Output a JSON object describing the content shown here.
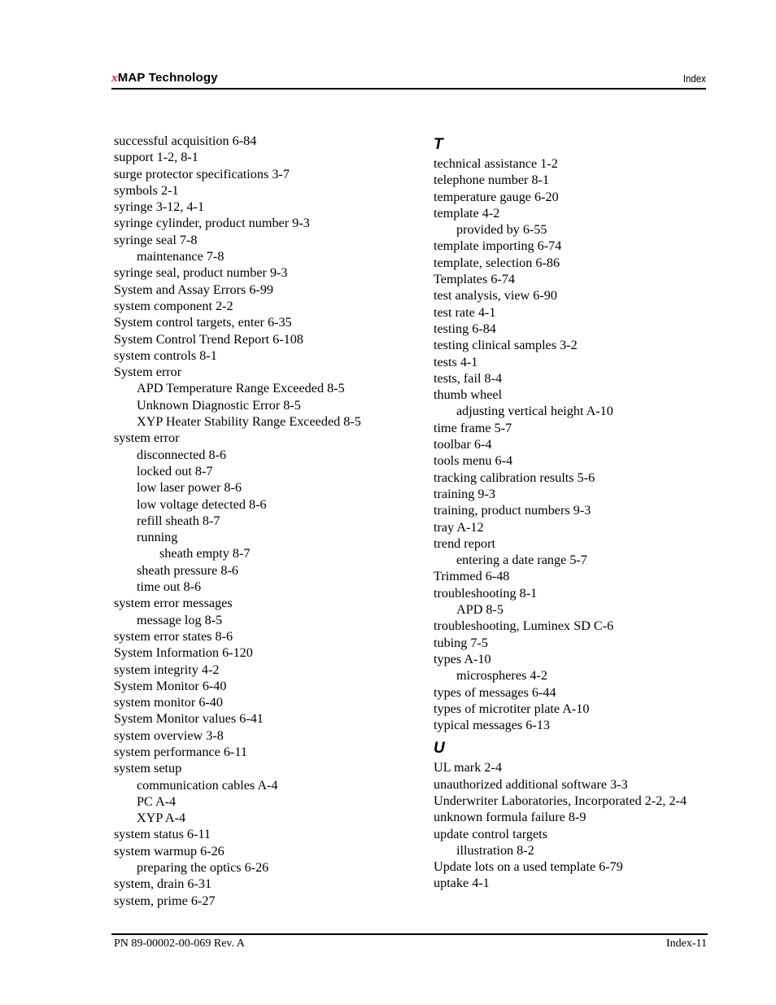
{
  "header": {
    "brand_prefix": "x",
    "brand_name": "MAP Technology",
    "section": "Index",
    "brand_color": "#e0201b"
  },
  "left_column": [
    {
      "text": "successful acquisition 6-84",
      "level": 0
    },
    {
      "text": "support 1-2, 8-1",
      "level": 0
    },
    {
      "text": "surge protector specifications 3-7",
      "level": 0
    },
    {
      "text": "symbols 2-1",
      "level": 0
    },
    {
      "text": "syringe 3-12, 4-1",
      "level": 0
    },
    {
      "text": "syringe cylinder, product number 9-3",
      "level": 0
    },
    {
      "text": "syringe seal 7-8",
      "level": 0
    },
    {
      "text": "maintenance 7-8",
      "level": 1
    },
    {
      "text": "syringe seal, product number 9-3",
      "level": 0
    },
    {
      "text": "System and Assay Errors 6-99",
      "level": 0
    },
    {
      "text": "system component 2-2",
      "level": 0
    },
    {
      "text": "System control targets, enter 6-35",
      "level": 0
    },
    {
      "text": "System Control Trend Report 6-108",
      "level": 0
    },
    {
      "text": "system controls 8-1",
      "level": 0
    },
    {
      "text": "System error",
      "level": 0
    },
    {
      "text": "APD Temperature Range Exceeded 8-5",
      "level": 1
    },
    {
      "text": "Unknown Diagnostic Error 8-5",
      "level": 1
    },
    {
      "text": "XYP Heater Stability Range Exceeded 8-5",
      "level": 1
    },
    {
      "text": "system error",
      "level": 0
    },
    {
      "text": "disconnected 8-6",
      "level": 1
    },
    {
      "text": "locked out 8-7",
      "level": 1
    },
    {
      "text": "low laser power 8-6",
      "level": 1
    },
    {
      "text": "low voltage detected 8-6",
      "level": 1
    },
    {
      "text": "refill sheath 8-7",
      "level": 1
    },
    {
      "text": "running",
      "level": 1
    },
    {
      "text": "sheath empty 8-7",
      "level": 2
    },
    {
      "text": "sheath pressure 8-6",
      "level": 1
    },
    {
      "text": "time out 8-6",
      "level": 1
    },
    {
      "text": "system error messages",
      "level": 0
    },
    {
      "text": "message log 8-5",
      "level": 1
    },
    {
      "text": "system error states 8-6",
      "level": 0
    },
    {
      "text": "System Information 6-120",
      "level": 0
    },
    {
      "text": "system integrity 4-2",
      "level": 0
    },
    {
      "text": "System Monitor 6-40",
      "level": 0
    },
    {
      "text": "system monitor 6-40",
      "level": 0
    },
    {
      "text": "System Monitor values 6-41",
      "level": 0
    },
    {
      "text": "system overview 3-8",
      "level": 0
    },
    {
      "text": "system performance 6-11",
      "level": 0
    },
    {
      "text": "system setup",
      "level": 0
    },
    {
      "text": "communication cables A-4",
      "level": 1
    },
    {
      "text": "PC A-4",
      "level": 1
    },
    {
      "text": "XYP A-4",
      "level": 1
    },
    {
      "text": "system status 6-11",
      "level": 0
    },
    {
      "text": "system warmup 6-26",
      "level": 0
    },
    {
      "text": "preparing the optics 6-26",
      "level": 1
    },
    {
      "text": "system, drain 6-31",
      "level": 0
    },
    {
      "text": "system, prime 6-27",
      "level": 0
    }
  ],
  "right_column": {
    "sections": [
      {
        "letter": "T",
        "entries": [
          {
            "text": "technical assistance 1-2",
            "level": 0
          },
          {
            "text": "telephone number 8-1",
            "level": 0
          },
          {
            "text": "temperature gauge 6-20",
            "level": 0
          },
          {
            "text": "template 4-2",
            "level": 0
          },
          {
            "text": "provided by 6-55",
            "level": 1
          },
          {
            "text": "template importing 6-74",
            "level": 0
          },
          {
            "text": "template, selection 6-86",
            "level": 0
          },
          {
            "text": "Templates 6-74",
            "level": 0
          },
          {
            "text": "test analysis, view 6-90",
            "level": 0
          },
          {
            "text": "test rate 4-1",
            "level": 0
          },
          {
            "text": "testing 6-84",
            "level": 0
          },
          {
            "text": "testing clinical samples 3-2",
            "level": 0
          },
          {
            "text": "tests 4-1",
            "level": 0
          },
          {
            "text": "tests, fail 8-4",
            "level": 0
          },
          {
            "text": "thumb wheel",
            "level": 0
          },
          {
            "text": "adjusting vertical height A-10",
            "level": 1
          },
          {
            "text": "time frame 5-7",
            "level": 0
          },
          {
            "text": "toolbar 6-4",
            "level": 0
          },
          {
            "text": "tools menu 6-4",
            "level": 0
          },
          {
            "text": "tracking calibration results 5-6",
            "level": 0
          },
          {
            "text": "training 9-3",
            "level": 0
          },
          {
            "text": "training, product numbers 9-3",
            "level": 0
          },
          {
            "text": "tray A-12",
            "level": 0
          },
          {
            "text": "trend report",
            "level": 0
          },
          {
            "text": "entering a date range 5-7",
            "level": 1
          },
          {
            "text": "Trimmed 6-48",
            "level": 0
          },
          {
            "text": "troubleshooting 8-1",
            "level": 0
          },
          {
            "text": "APD 8-5",
            "level": 1
          },
          {
            "text": "troubleshooting, Luminex SD C-6",
            "level": 0
          },
          {
            "text": "tubing 7-5",
            "level": 0
          },
          {
            "text": "types A-10",
            "level": 0
          },
          {
            "text": "microspheres 4-2",
            "level": 1
          },
          {
            "text": "types of messages 6-44",
            "level": 0
          },
          {
            "text": "types of microtiter plate A-10",
            "level": 0
          },
          {
            "text": "typical messages 6-13",
            "level": 0
          }
        ]
      },
      {
        "letter": "U",
        "entries": [
          {
            "text": "UL mark 2-4",
            "level": 0
          },
          {
            "text": "unauthorized additional software 3-3",
            "level": 0
          },
          {
            "text": "Underwriter Laboratories, Incorporated 2-2, 2-4",
            "level": 0
          },
          {
            "text": "unknown formula failure 8-9",
            "level": 0
          },
          {
            "text": "update control targets",
            "level": 0
          },
          {
            "text": "illustration 8-2",
            "level": 1
          },
          {
            "text": "Update lots on a used template 6-79",
            "level": 0
          },
          {
            "text": "uptake 4-1",
            "level": 0
          }
        ]
      }
    ]
  },
  "footer": {
    "part_number": "PN 89-00002-00-069 Rev. A",
    "page": "Index-11"
  }
}
